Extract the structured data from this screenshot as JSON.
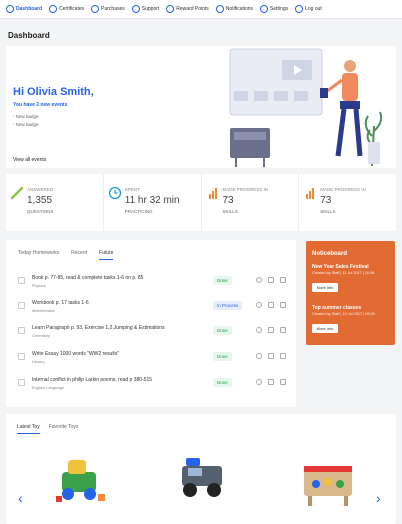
{
  "nav": [
    {
      "label": "Dashboard",
      "active": true
    },
    {
      "label": "Certificates"
    },
    {
      "label": "Purchases"
    },
    {
      "label": "Support"
    },
    {
      "label": "Reward Points"
    },
    {
      "label": "Notifications"
    },
    {
      "label": "Settings"
    },
    {
      "label": "Log out"
    }
  ],
  "page": {
    "title": "Dashboard"
  },
  "hero": {
    "greeting": "Hi Olivia Smith,",
    "subtitle": "You have 2 new events",
    "badges": [
      "- New badge",
      "- New badge"
    ],
    "view_all": "View all events"
  },
  "stats": [
    {
      "label": "Answered",
      "value": "1,355",
      "unit": "Questions",
      "icon": "pencil-icon"
    },
    {
      "label": "Spent",
      "value": "11 hr 32 min",
      "unit": "Practicing",
      "icon": "clock-icon"
    },
    {
      "label": "Made progress in",
      "value": "73",
      "unit": "Skills",
      "icon": "bar-chart-icon"
    },
    {
      "label": "Made progress in",
      "value": "73",
      "unit": "Skills",
      "icon": "bar-chart-icon"
    }
  ],
  "homework": {
    "tabs": [
      "Today Homeworks",
      "Recent",
      "Future"
    ],
    "active_tab": "Future",
    "items": [
      {
        "title": "Book p. 77-85, read & complete tasks 1-6 on p. 85",
        "subject": "Physics",
        "status": "Done"
      },
      {
        "title": "Workbook p. 17 tasks 1-6",
        "subject": "Mathematics",
        "status": "In Process"
      },
      {
        "title": "Learn Paragraph p. 93, Exercise 1,2,Jumping & Estimations",
        "subject": "Chemistry",
        "status": "Done"
      },
      {
        "title": "Write Essay 1000 words \"WW2 results\"",
        "subject": "History",
        "status": "Done"
      },
      {
        "title": "Internal conflict in philip Larkin poems, read p 380-515",
        "subject": "English Language",
        "status": "Done"
      }
    ]
  },
  "noticeboard": {
    "title": "Noticeboard",
    "items": [
      {
        "title": "New Year Sales Festival",
        "meta": "Created by Staff | 11 Jul 2017 | 10:06",
        "button": "More info"
      },
      {
        "title": "Top summer classes",
        "meta": "Created by Staff | 10 Jul 2017 | 09:05",
        "button": "More info"
      }
    ]
  },
  "toys": {
    "tabs": [
      "Latest Toy",
      "Favorite Toys"
    ],
    "active_tab": "Latest Toy",
    "prev": "‹",
    "next": "›"
  },
  "colors": {
    "accent": "#2563eb",
    "notice": "#e26a33",
    "done": "#16a34a"
  }
}
